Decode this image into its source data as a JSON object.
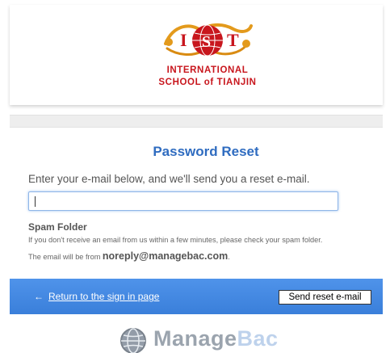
{
  "school": {
    "logo_letters": "IST",
    "name_line1": "INTERNATIONAL",
    "name_line2": "SCHOOL of TIANJIN"
  },
  "form": {
    "title": "Password Reset",
    "instructions": "Enter your e-mail below, and we'll send you a reset e-mail.",
    "email_value": "",
    "email_placeholder": ""
  },
  "spam": {
    "heading": "Spam Folder",
    "line1": "If you don't receive an email from us within a few minutes, please check your spam folder.",
    "line2_prefix": "The email will be from ",
    "sender": "noreply@managebac.com",
    "line2_suffix": "."
  },
  "actions": {
    "return_label": "Return to the sign in page",
    "send_label": "Send reset e-mail"
  },
  "footer": {
    "brand_part1": "Manage",
    "brand_part2": "Bac"
  },
  "colors": {
    "school_red": "#c8161d",
    "title_blue": "#2f6cc0",
    "bar_blue": "#3f85df"
  },
  "icons": {
    "return_arrow": "left-arrow-icon",
    "logo": "school-dragon-globe-logo",
    "brand": "managebac-globe-icon"
  }
}
